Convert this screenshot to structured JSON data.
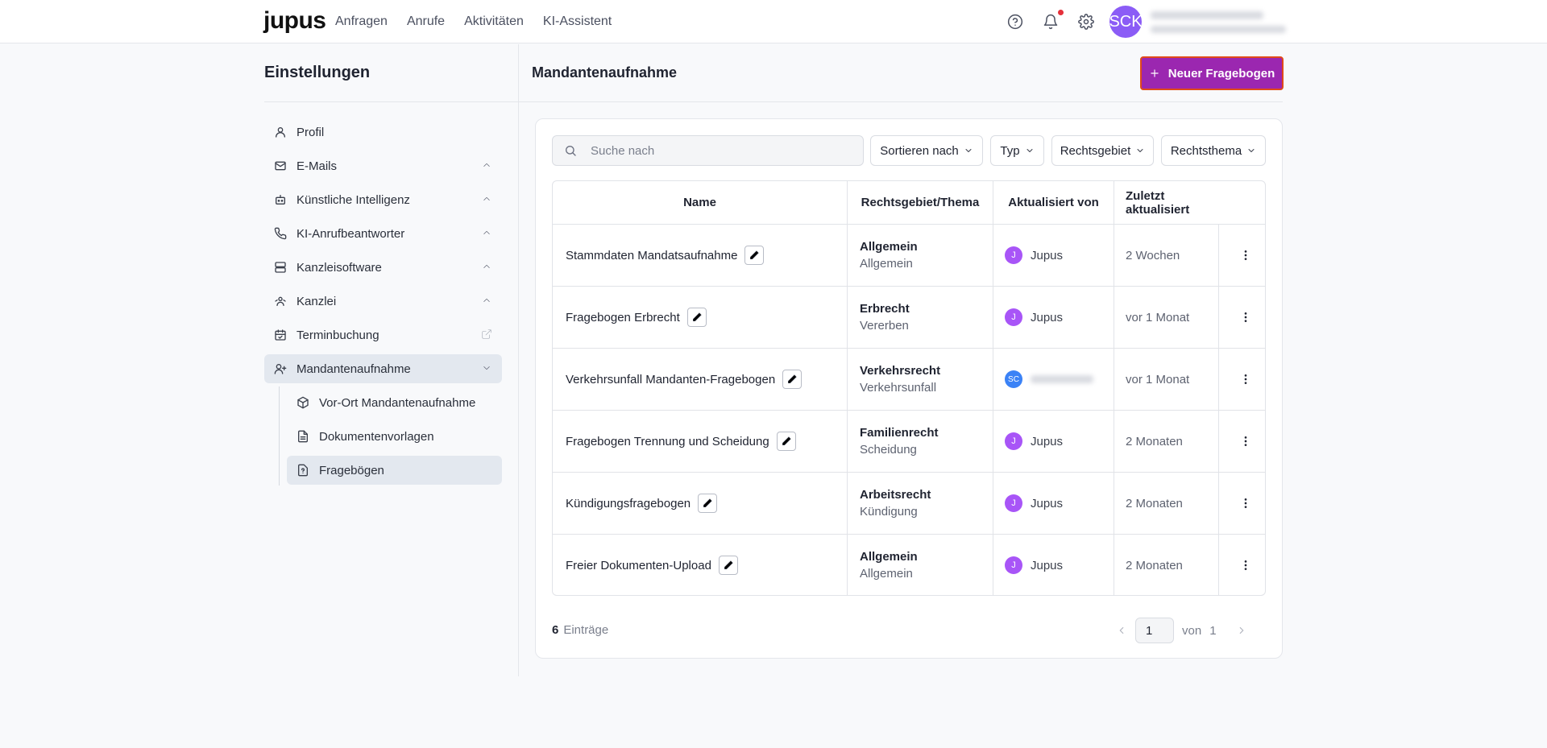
{
  "topbar": {
    "logo": "jupus",
    "nav": [
      "Anfragen",
      "Anrufe",
      "Aktivitäten",
      "KI-Assistent"
    ],
    "avatar_initials": "SCK"
  },
  "sidebar": {
    "title": "Einstellungen",
    "items": [
      {
        "label": "Profil",
        "icon": "user-icon",
        "chevron": false
      },
      {
        "label": "E-Mails",
        "icon": "mail-icon",
        "chevron": true
      },
      {
        "label": "Künstliche Intelligenz",
        "icon": "bot-icon",
        "chevron": true
      },
      {
        "label": "KI-Anrufbeantworter",
        "icon": "phone-icon",
        "chevron": true
      },
      {
        "label": "Kanzleisoftware",
        "icon": "server-icon",
        "chevron": true
      },
      {
        "label": "Kanzlei",
        "icon": "team-icon",
        "chevron": true
      },
      {
        "label": "Terminbuchung",
        "icon": "calendar-icon",
        "external": true
      },
      {
        "label": "Mandantenaufnahme",
        "icon": "user-plus-icon",
        "expanded": true
      }
    ],
    "subitems": [
      {
        "label": "Vor-Ort Mandantenaufnahme",
        "icon": "cube-icon"
      },
      {
        "label": "Dokumentenvorlagen",
        "icon": "document-icon"
      },
      {
        "label": "Fragebögen",
        "icon": "questionnaire-icon",
        "active": true
      }
    ]
  },
  "main": {
    "title": "Mandantenaufnahme",
    "new_button": "Neuer Fragebogen",
    "search_placeholder": "Suche nach",
    "filters": [
      "Sortieren nach",
      "Typ",
      "Rechtsgebiet",
      "Rechtsthema"
    ],
    "columns": [
      "Name",
      "Rechtsgebiet/Thema",
      "Aktualisiert von",
      "Zuletzt aktualisiert"
    ],
    "rows": [
      {
        "name": "Stammdaten Mandatsaufnahme",
        "area": "Allgemein",
        "topic": "Allgemein",
        "avatar": "J",
        "user": "Jupus",
        "updated": "2 Wochen"
      },
      {
        "name": "Fragebogen Erbrecht",
        "area": "Erbrecht",
        "topic": "Vererben",
        "avatar": "J",
        "user": "Jupus",
        "updated": "vor 1 Monat"
      },
      {
        "name": "Verkehrsunfall Mandanten-Fragebogen",
        "area": "Verkehrsrecht",
        "topic": "Verkehrsunfall",
        "avatar": "SC",
        "user": "",
        "updated": "vor 1 Monat"
      },
      {
        "name": "Fragebogen Trennung und Scheidung",
        "area": "Familienrecht",
        "topic": "Scheidung",
        "avatar": "J",
        "user": "Jupus",
        "updated": "2 Monaten"
      },
      {
        "name": "Kündigungsfragebogen",
        "area": "Arbeitsrecht",
        "topic": "Kündigung",
        "avatar": "J",
        "user": "Jupus",
        "updated": "2 Monaten"
      },
      {
        "name": "Freier Dokumenten-Upload",
        "area": "Allgemein",
        "topic": "Allgemein",
        "avatar": "J",
        "user": "Jupus",
        "updated": "2 Monaten"
      }
    ],
    "footer": {
      "count": "6",
      "count_label": "Einträge",
      "page": "1",
      "of_label": "von",
      "total_pages": "1"
    }
  },
  "colors": {
    "accent": "#9b27b0",
    "active_bg": "#e3e8ef",
    "avatar_purple": "#a855f7",
    "avatar_blue": "#3b82f6"
  }
}
